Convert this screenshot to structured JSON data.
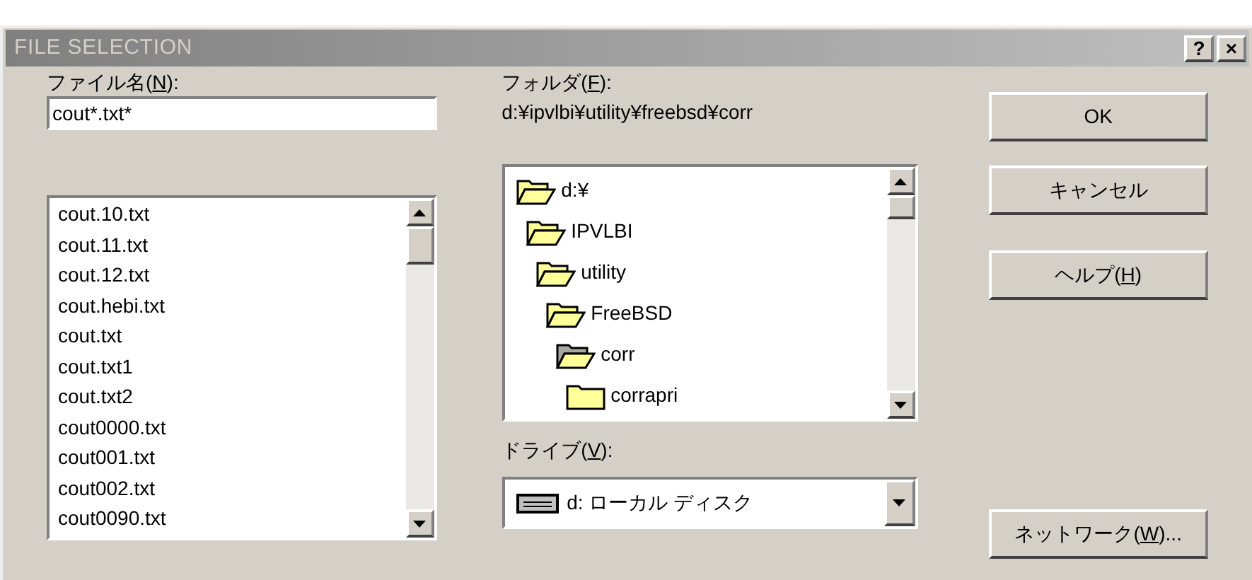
{
  "window": {
    "title": "FILE SELECTION",
    "title_buttons": [
      "?",
      "×"
    ]
  },
  "file_name": {
    "label": {
      "before": "ファイル名(",
      "mnemonic": "N",
      "after": "):"
    },
    "value": "cout*.txt*"
  },
  "files": [
    {
      "name": "cout.10.txt"
    },
    {
      "name": "cout.11.txt"
    },
    {
      "name": "cout.12.txt"
    },
    {
      "name": "cout.hebi.txt"
    },
    {
      "name": "cout.txt"
    },
    {
      "name": "cout.txt1"
    },
    {
      "name": "cout.txt2"
    },
    {
      "name": "cout0000.txt"
    },
    {
      "name": "cout001.txt"
    },
    {
      "name": "cout002.txt"
    },
    {
      "name": "cout0090.txt"
    }
  ],
  "folder": {
    "label": {
      "before": "フォルダ(",
      "mnemonic": "F",
      "after": "):"
    },
    "path": "d:¥ipvlbi¥utility¥freebsd¥corr"
  },
  "folders": [
    {
      "name": "d:¥",
      "open": true,
      "selected": false,
      "children": [
        {
          "name": "IPVLBI",
          "open": true,
          "selected": false,
          "children": [
            {
              "name": "utility",
              "open": true,
              "selected": false,
              "children": [
                {
                  "name": "FreeBSD",
                  "open": true,
                  "selected": false,
                  "children": [
                    {
                      "name": "corr",
                      "open": true,
                      "selected": true,
                      "children": [
                        {
                          "name": "corrapri",
                          "open": false,
                          "selected": false
                        }
                      ]
                    }
                  ]
                }
              ]
            }
          ]
        }
      ]
    }
  ],
  "drive": {
    "label": {
      "before": "ドライブ(",
      "mnemonic": "V",
      "after": "):"
    },
    "value": "d: ローカル ディスク"
  },
  "buttons": [
    {
      "label": {
        "before": "OK"
      },
      "kind": "ok"
    },
    {
      "label": {
        "before": "キャンセル"
      },
      "kind": "cancel"
    },
    {
      "label": {
        "before": "ヘルプ(",
        "mnemonic": "H",
        "after": ")"
      },
      "kind": "help"
    },
    {
      "label": {
        "before": "ネットワーク(",
        "mnemonic": "W",
        "after": ")..."
      },
      "kind": "network"
    }
  ]
}
